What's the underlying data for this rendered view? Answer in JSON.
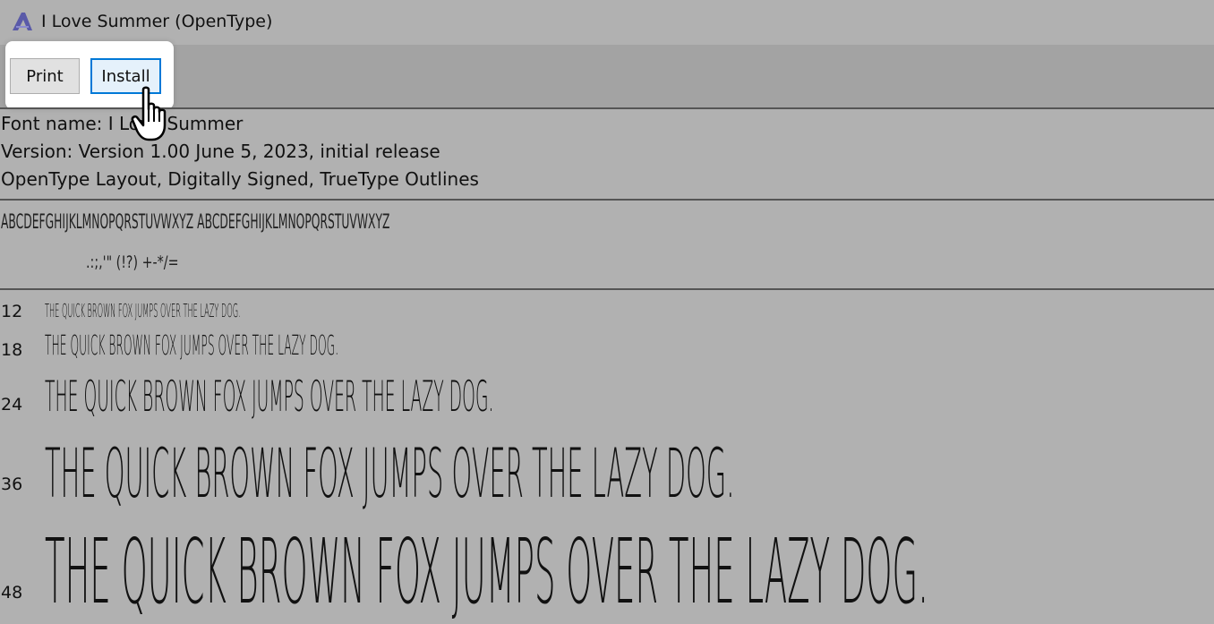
{
  "window": {
    "title": "I Love Summer (OpenType)",
    "icon": "font-viewer-icon"
  },
  "toolbar": {
    "print_label": "Print",
    "install_label": "Install"
  },
  "font_info": {
    "name_line": "Font name: I Love Summer",
    "version_line": "Version: Version 1.00 June 5, 2023, initial release",
    "features_line": "OpenType Layout, Digitally Signed, TrueType Outlines"
  },
  "charset": {
    "letters": "ABCDEFGHIJKLMNOPQRSTUVWXYZ ABCDEFGHIJKLMNOPQRSTUVWXYZ",
    "symbols": ".:;,'\" (!?) +-*/="
  },
  "samples": [
    {
      "size": "12",
      "text": "THE QUICK BROWN FOX JUMPS OVER THE LAZY DOG."
    },
    {
      "size": "18",
      "text": "THE QUICK BROWN FOX JUMPS OVER THE LAZY DOG."
    },
    {
      "size": "24",
      "text": "THE QUICK BROWN FOX JUMPS OVER THE LAZY DOG."
    },
    {
      "size": "36",
      "text": "THE QUICK BROWN FOX JUMPS OVER THE LAZY DOG."
    },
    {
      "size": "48",
      "text": "THE QUICK BROWN FOX JUMPS OVER THE LAZY DOG."
    }
  ],
  "colors": {
    "background": "#b1b1b1",
    "toolbar": "#a3a3a3",
    "install_border": "#0078d7"
  },
  "cursor": "hand-pointer-icon"
}
